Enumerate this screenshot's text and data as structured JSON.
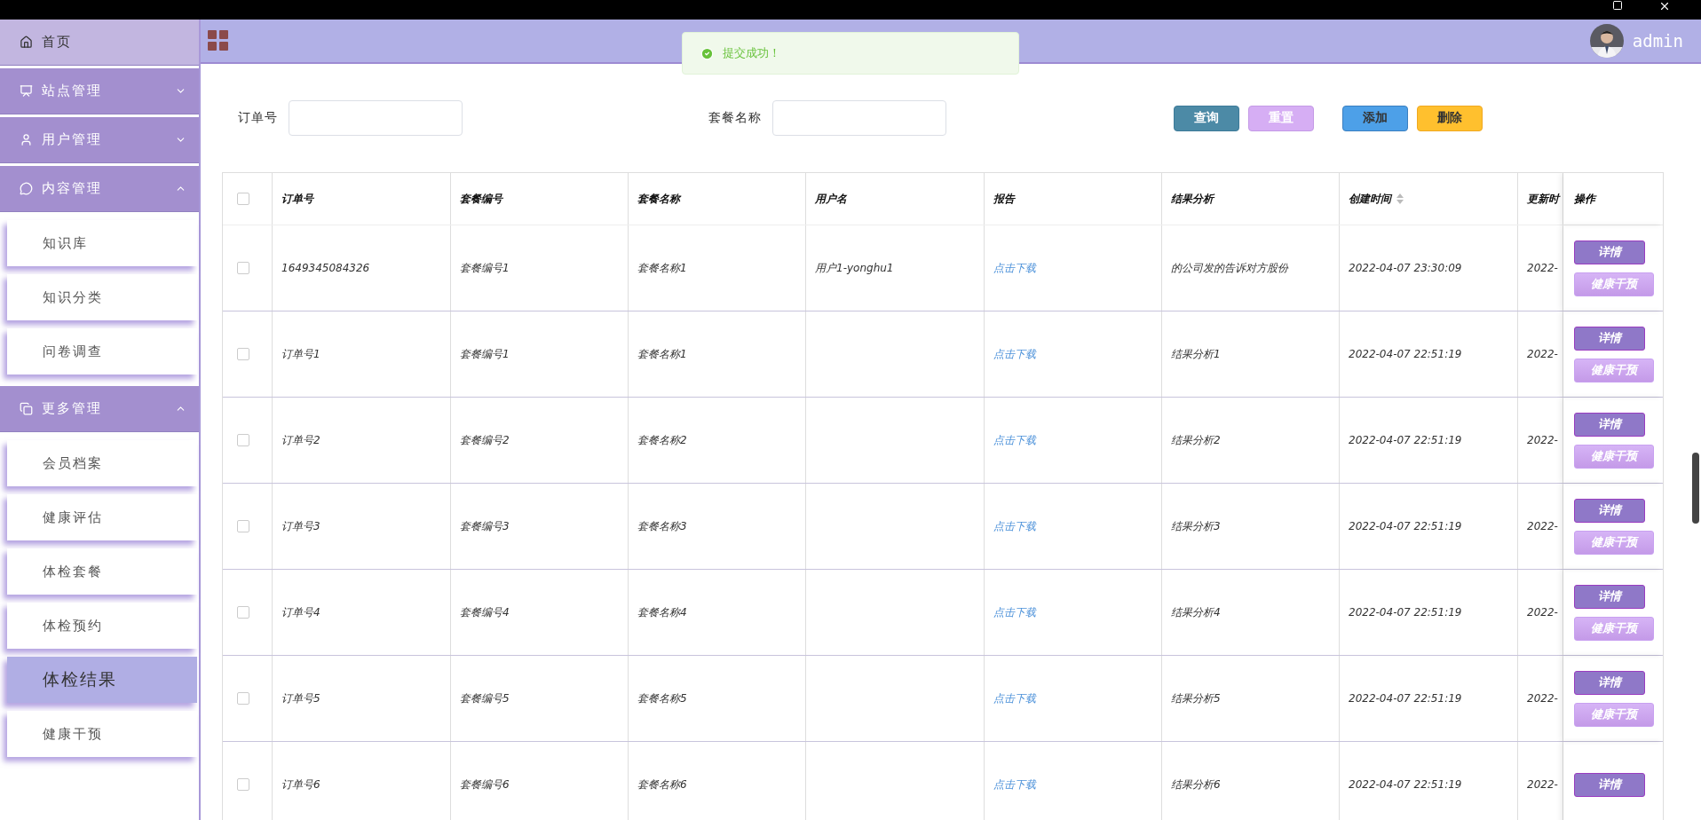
{
  "sidebar": {
    "items": [
      {
        "kind": "link",
        "label": "首页"
      },
      {
        "kind": "group",
        "label": "站点管理",
        "expanded": false
      },
      {
        "kind": "group",
        "label": "用户管理",
        "expanded": false
      },
      {
        "kind": "group",
        "label": "内容管理",
        "expanded": true,
        "children": [
          {
            "label": "知识库",
            "selected": false
          },
          {
            "label": "知识分类",
            "selected": false
          },
          {
            "label": "问卷调查",
            "selected": false
          }
        ]
      },
      {
        "kind": "group",
        "label": "更多管理",
        "expanded": true,
        "children": [
          {
            "label": "会员档案",
            "selected": false
          },
          {
            "label": "健康评估",
            "selected": false
          },
          {
            "label": "体检套餐",
            "selected": false
          },
          {
            "label": "体检预约",
            "selected": false
          },
          {
            "label": "体检结果",
            "selected": true
          },
          {
            "label": "健康干预",
            "selected": false
          }
        ]
      }
    ]
  },
  "header": {
    "user": "admin"
  },
  "toast": {
    "message": "提交成功！"
  },
  "search": {
    "fields": [
      {
        "label": "订单号"
      },
      {
        "label": "套餐名称"
      }
    ],
    "buttons": [
      {
        "kind": "search",
        "label": "查询"
      },
      {
        "kind": "reset",
        "label": "重置"
      },
      {
        "kind": "add",
        "label": "添加"
      },
      {
        "kind": "delete",
        "label": "删除"
      }
    ]
  },
  "table": {
    "all_checked": false,
    "columns": [
      {
        "label": "订单号",
        "sortable": false
      },
      {
        "label": "套餐编号",
        "sortable": false
      },
      {
        "label": "套餐名称",
        "sortable": false
      },
      {
        "label": "用户名",
        "sortable": false
      },
      {
        "label": "报告",
        "sortable": false
      },
      {
        "label": "结果分析",
        "sortable": false
      },
      {
        "label": "创建时间",
        "sortable": true
      },
      {
        "label": "更新时"
      },
      {
        "label": "操作"
      }
    ],
    "rows": [
      {
        "checked": false,
        "cells": [
          "1649345084326",
          "套餐编号1",
          "套餐名称1",
          "用户1-yonghu1",
          "点击下载",
          "的公司发的告诉对方股份",
          "2022-04-07 23:30:09",
          "2022-"
        ],
        "actions": [
          "详情",
          "健康干预"
        ]
      },
      {
        "checked": false,
        "cells": [
          "订单号1",
          "套餐编号1",
          "套餐名称1",
          null,
          "点击下载",
          "结果分析1",
          "2022-04-07 22:51:19",
          "2022-"
        ],
        "actions": [
          "详情",
          "健康干预"
        ]
      },
      {
        "checked": false,
        "cells": [
          "订单号2",
          "套餐编号2",
          "套餐名称2",
          null,
          "点击下载",
          "结果分析2",
          "2022-04-07 22:51:19",
          "2022-"
        ],
        "actions": [
          "详情",
          "健康干预"
        ]
      },
      {
        "checked": false,
        "cells": [
          "订单号3",
          "套餐编号3",
          "套餐名称3",
          null,
          "点击下载",
          "结果分析3",
          "2022-04-07 22:51:19",
          "2022-"
        ],
        "actions": [
          "详情",
          "健康干预"
        ]
      },
      {
        "checked": false,
        "cells": [
          "订单号4",
          "套餐编号4",
          "套餐名称4",
          null,
          "点击下载",
          "结果分析4",
          "2022-04-07 22:51:19",
          "2022-"
        ],
        "actions": [
          "详情",
          "健康干预"
        ]
      },
      {
        "checked": false,
        "cells": [
          "订单号5",
          "套餐编号5",
          "套餐名称5",
          null,
          "点击下载",
          "结果分析5",
          "2022-04-07 22:51:19",
          "2022-"
        ],
        "actions": [
          "详情",
          "健康干预"
        ]
      },
      {
        "checked": false,
        "cells": [
          "订单号6",
          "套餐编号6",
          "套餐名称6",
          null,
          "点击下载",
          "结果分析6",
          "2022-04-07 22:51:19",
          "2022-"
        ],
        "actions": [
          "详情"
        ]
      }
    ]
  }
}
